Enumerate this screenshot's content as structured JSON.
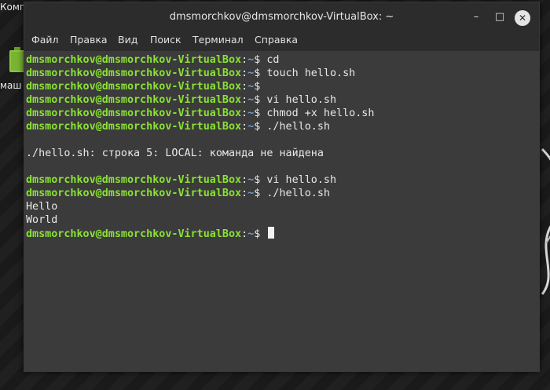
{
  "desktop": {
    "icon_label_top": "Комп",
    "icon_label": "маш"
  },
  "window": {
    "title": "dmsmorchkov@dmsmorchkov-VirtualBox: ~",
    "controls": {
      "minimize": "–",
      "maximize": "□",
      "close": "✕"
    }
  },
  "menu": [
    "Файл",
    "Правка",
    "Вид",
    "Поиск",
    "Терминал",
    "Справка"
  ],
  "prompt": {
    "user_host": "dmsmorchkov@dmsmorchkov-VirtualBox",
    "colon": ":",
    "path": "~",
    "symbol": "$"
  },
  "lines": [
    {
      "type": "prompt",
      "command": " cd"
    },
    {
      "type": "prompt",
      "command": " touch hello.sh"
    },
    {
      "type": "prompt",
      "command": ""
    },
    {
      "type": "prompt",
      "command": " vi hello.sh"
    },
    {
      "type": "prompt",
      "command": " chmod +x hello.sh"
    },
    {
      "type": "prompt",
      "command": " ./hello.sh"
    },
    {
      "type": "output",
      "text": ""
    },
    {
      "type": "output",
      "text": "./hello.sh: строка 5: LOCAL: команда не найдена"
    },
    {
      "type": "output",
      "text": ""
    },
    {
      "type": "prompt",
      "command": " vi hello.sh"
    },
    {
      "type": "prompt",
      "command": " ./hello.sh"
    },
    {
      "type": "output",
      "text": "Hello"
    },
    {
      "type": "output",
      "text": "World"
    },
    {
      "type": "prompt",
      "command": " ",
      "cursor": true
    }
  ],
  "colors": {
    "prompt_user": "#8ae234",
    "prompt_path": "#729fcf",
    "terminal_bg": "#3b3b3b",
    "titlebar_bg": "#2c2c2c"
  }
}
